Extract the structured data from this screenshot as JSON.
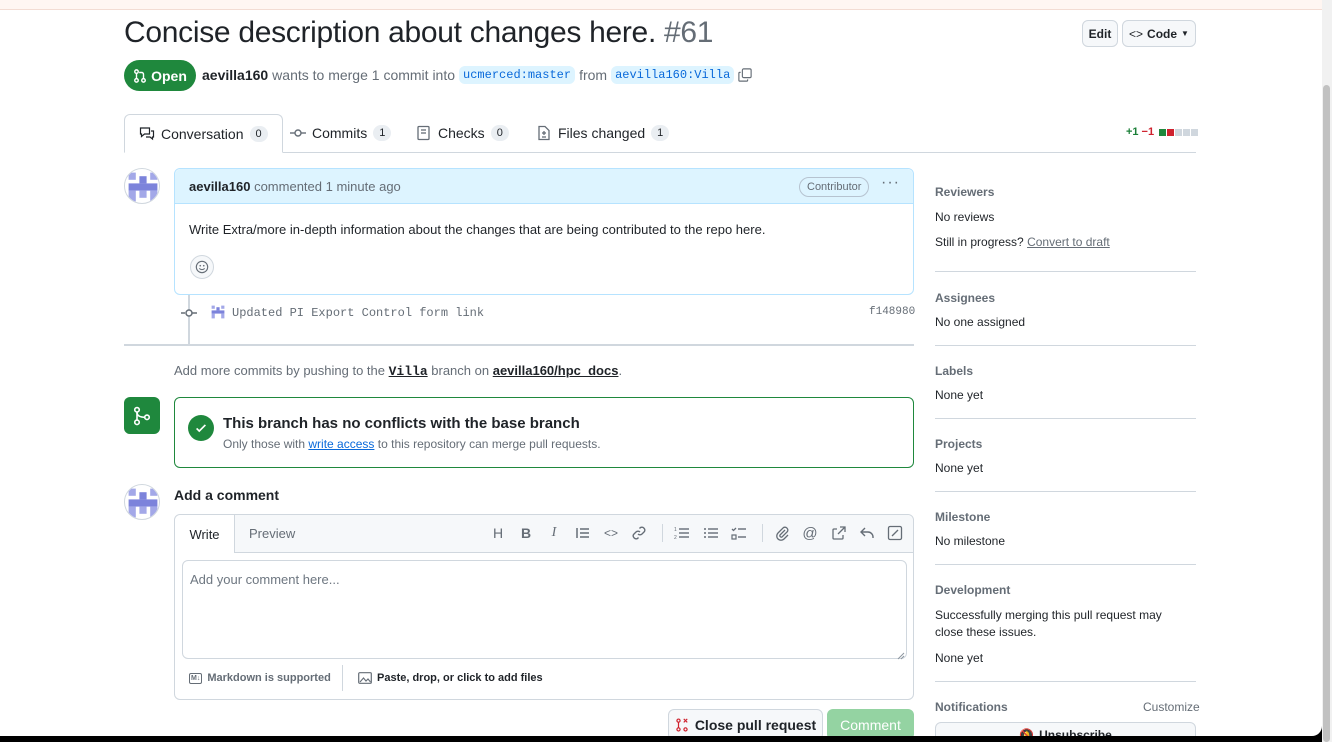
{
  "pr": {
    "title": "Concise description about changes here.",
    "number": "#61",
    "state": "Open",
    "author": "aevilla160",
    "merge_text": "wants to merge 1 commit into",
    "base_branch": "ucmerced:master",
    "from_text": "from",
    "head_branch": "aevilla160:Villa"
  },
  "header": {
    "edit_label": "Edit",
    "code_label": "Code"
  },
  "tabs": [
    {
      "label": "Conversation",
      "count": "0"
    },
    {
      "label": "Commits",
      "count": "1"
    },
    {
      "label": "Checks",
      "count": "0"
    },
    {
      "label": "Files changed",
      "count": "1"
    }
  ],
  "diffstat": {
    "added": "+1",
    "removed": "−1"
  },
  "comment": {
    "author": "aevilla160",
    "action": "commented 1 minute ago",
    "badge": "Contributor",
    "body": "Write Extra/more in-depth information about the changes that are being contributed to the repo here."
  },
  "commit": {
    "message": "Updated PI Export Control form link",
    "sha": "f148980"
  },
  "push_hint": {
    "prefix": "Add more commits by pushing to the",
    "branch": "Villa",
    "mid": "branch on",
    "repo": "aevilla160/hpc_docs",
    "suffix": "."
  },
  "merge_box": {
    "title": "This branch has no conflicts with the base branch",
    "sub_prefix": "Only those with",
    "sub_link": "write access",
    "sub_suffix": "to this repository can merge pull requests."
  },
  "add_comment": {
    "heading": "Add a comment",
    "tab_write": "Write",
    "tab_preview": "Preview",
    "placeholder": "Add your comment here...",
    "markdown_label": "Markdown is supported",
    "attach_label": "Paste, drop, or click to add files",
    "close_label": "Close pull request",
    "comment_label": "Comment"
  },
  "sidebar": {
    "reviewers_h": "Reviewers",
    "reviewers_v": "No reviews",
    "progress_prefix": "Still in progress?",
    "progress_link": "Convert to draft",
    "assignees_h": "Assignees",
    "assignees_v": "No one assigned",
    "labels_h": "Labels",
    "labels_v": "None yet",
    "projects_h": "Projects",
    "projects_v": "None yet",
    "milestone_h": "Milestone",
    "milestone_v": "No milestone",
    "development_h": "Development",
    "development_v": "Successfully merging this pull request may close these issues.",
    "development_v2": "None yet",
    "notifications_h": "Notifications",
    "customize": "Customize",
    "unsubscribe": "Unsubscribe"
  },
  "colors": {
    "green": "#1f883d",
    "blue": "#0969da",
    "red": "#cf222e"
  }
}
